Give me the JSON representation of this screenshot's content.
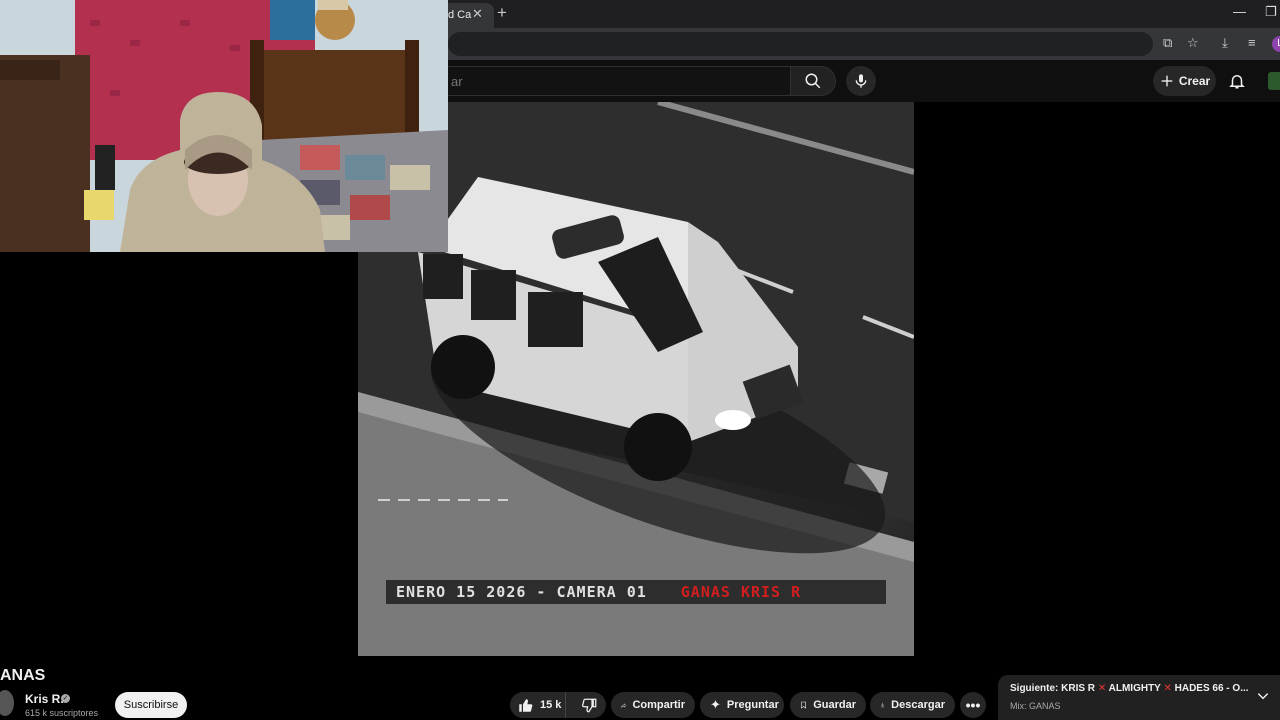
{
  "browser": {
    "tab_title": "d Ca",
    "tab_close": "✕",
    "new_tab": "+",
    "profile_initial": "L"
  },
  "header": {
    "search_placeholder": "ar",
    "create_label": "Crear"
  },
  "video": {
    "osd_text": "ENERO 15 2026 - CAMERA 01",
    "osd_tag": "GANAS KRIS R"
  },
  "below_video": {
    "title": "ANAS",
    "channel_name": "Kris R.",
    "subscribers": "615 k suscriptores",
    "subscribe_label": "Suscribirse",
    "likes": "15 k",
    "share_label": "Compartir",
    "ask_label": "Preguntar",
    "save_label": "Guardar",
    "download_label": "Descargar"
  },
  "next_up": {
    "prefix": "Siguiente:",
    "part1": "KRIS R",
    "part2": "ALMIGHTY",
    "part3": "HADES 66 - O...",
    "separator": "✕",
    "mix": "Mix: GANAS"
  }
}
